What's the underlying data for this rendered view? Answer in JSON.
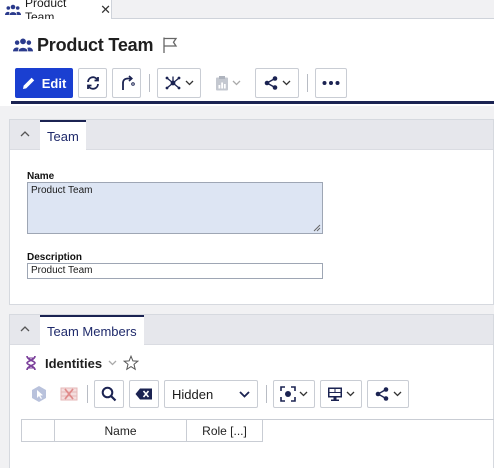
{
  "tab": {
    "label": "Product Team",
    "close": "✕"
  },
  "header": {
    "title": "Product Team"
  },
  "toolbar": {
    "edit_label": "Edit"
  },
  "team_panel": {
    "tab_label": "Team",
    "name_label": "Name",
    "name_value": "Product Team",
    "description_label": "Description",
    "description_value": "Product Team"
  },
  "members_panel": {
    "tab_label": "Team Members",
    "subpanel_title": "Identities",
    "filter_value": "Hidden",
    "columns": [
      "Name",
      "Role [...]"
    ]
  },
  "colors": {
    "accent": "#1a3fd1",
    "navy": "#1b2352",
    "field_bg": "#dde5f3"
  }
}
